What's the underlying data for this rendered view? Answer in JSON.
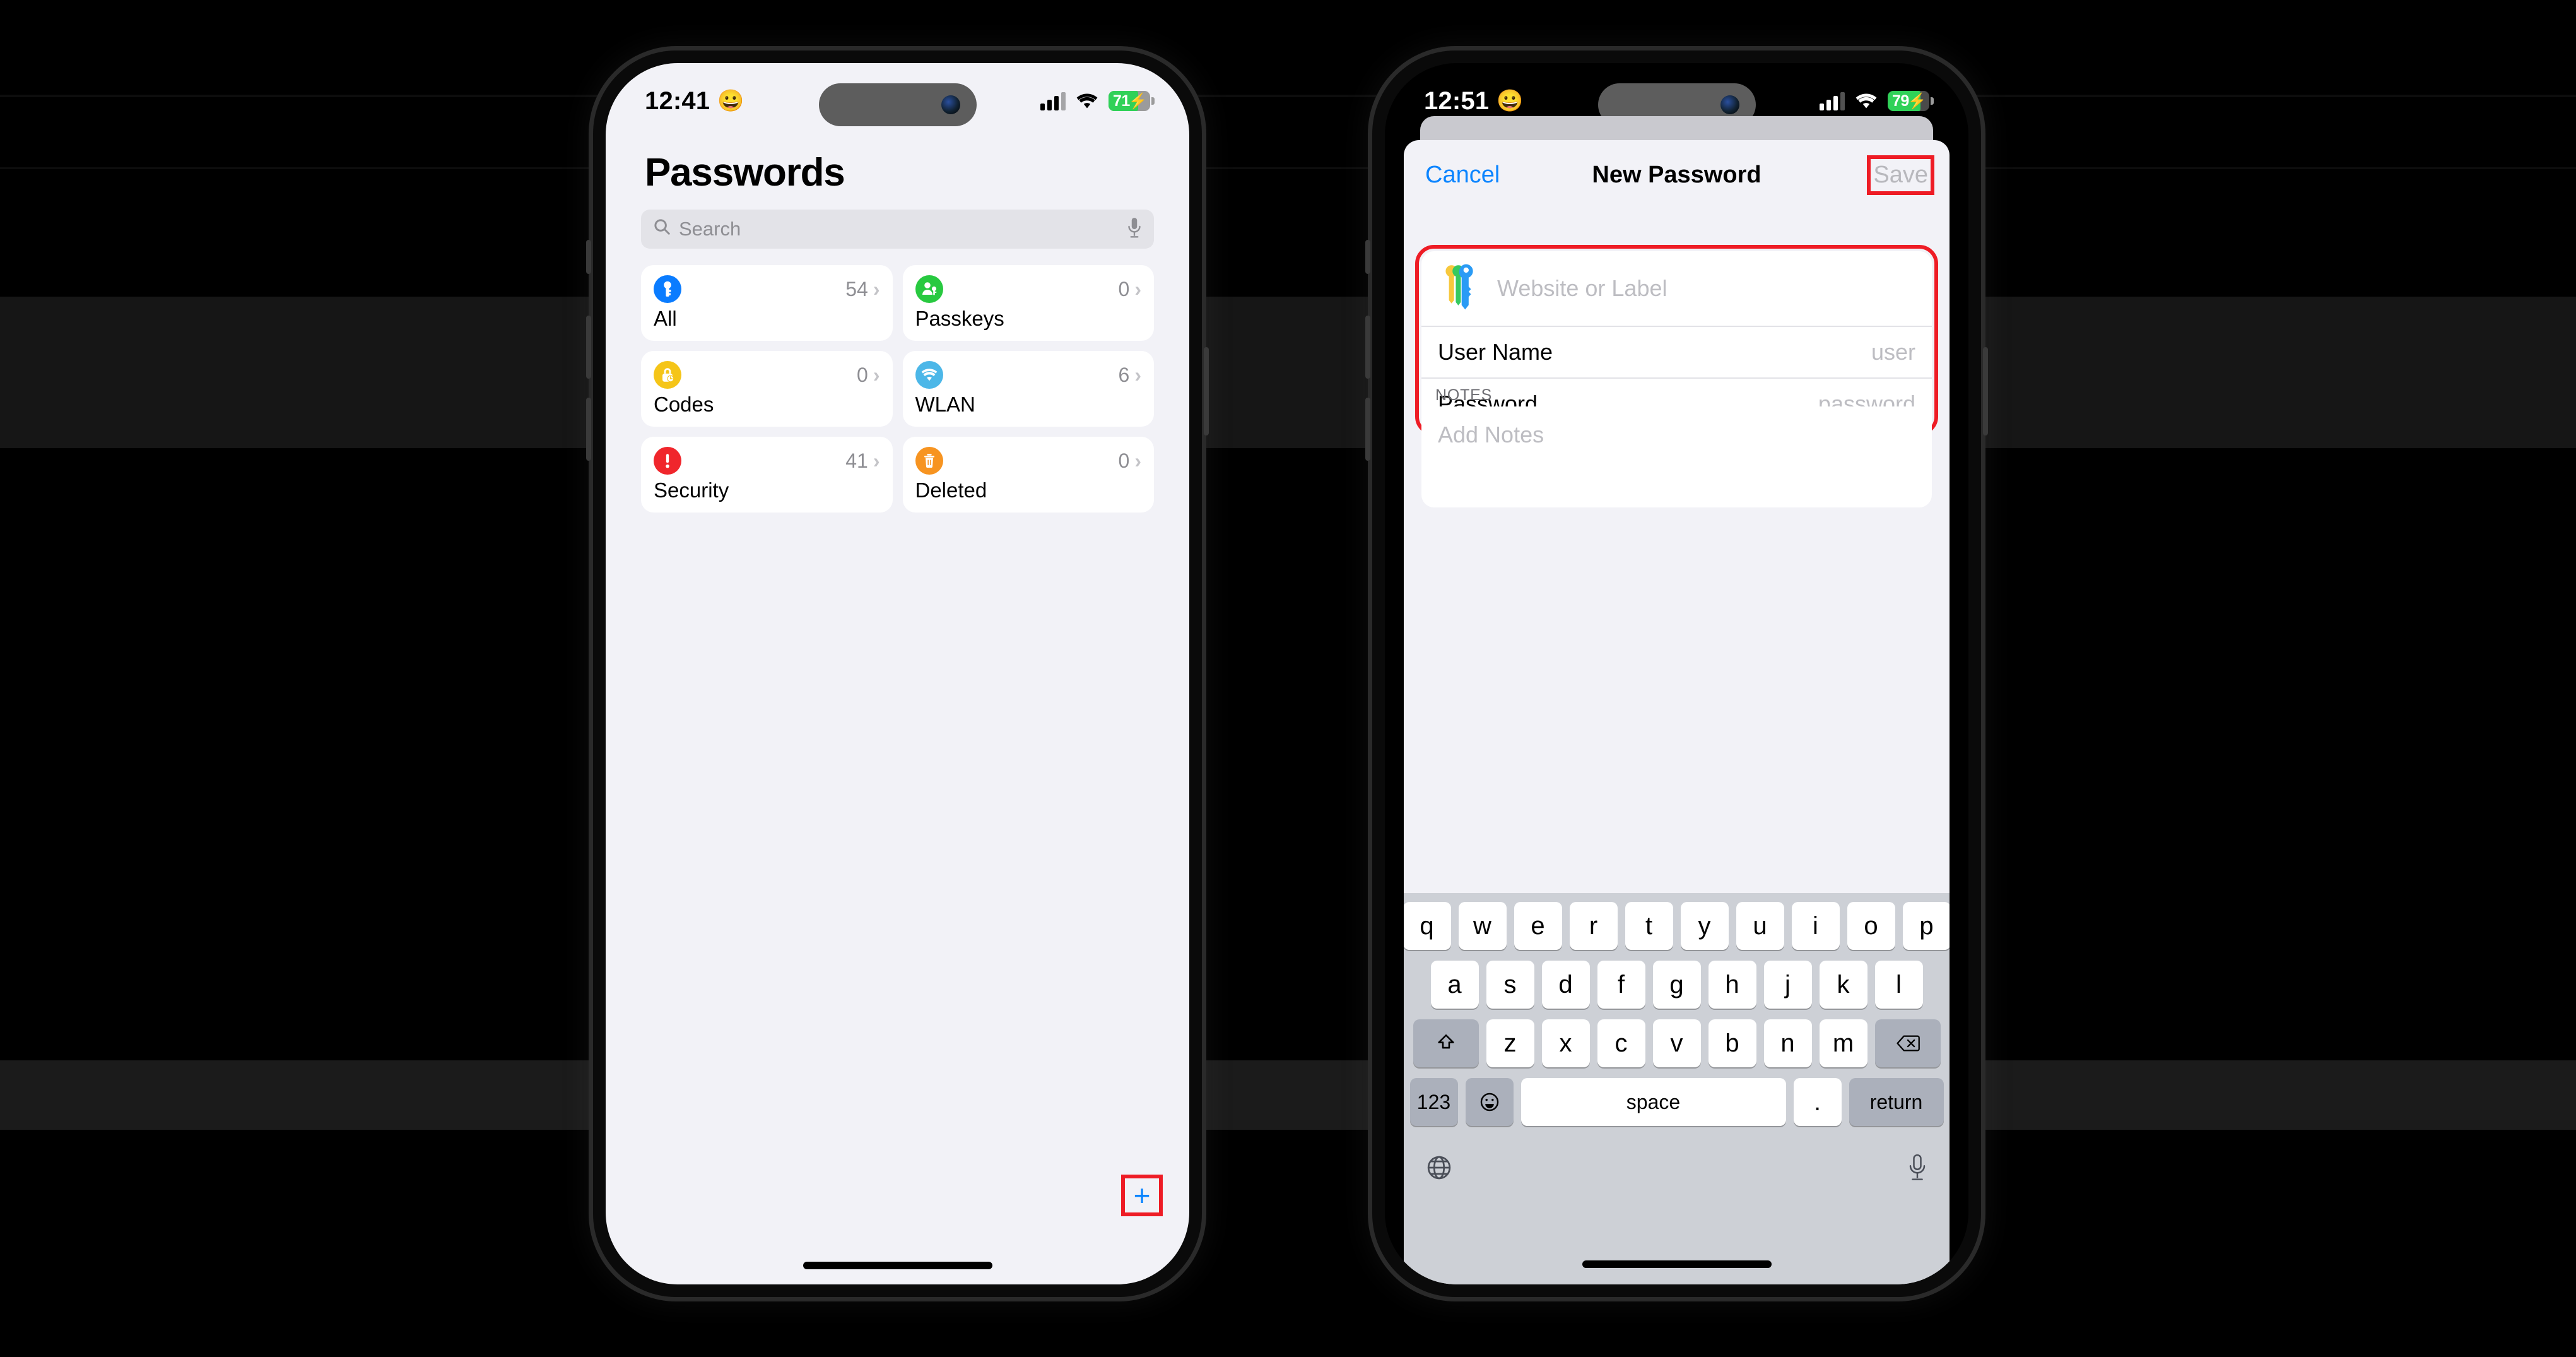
{
  "background": {
    "color": "#000000"
  },
  "accent": {
    "blue": "#0a84ff",
    "highlight_red": "#ee1c25"
  },
  "left_phone": {
    "status_bar": {
      "time": "12:41",
      "face_emoji": "😀",
      "battery_percent": "71",
      "signal_icon": "cellular-bars-icon",
      "wifi_icon": "wifi-icon",
      "battery_icon": "battery-charging-icon"
    },
    "page_title": "Passwords",
    "search": {
      "placeholder": "Search",
      "icon": "search-icon",
      "mic_icon": "microphone-icon"
    },
    "categories": [
      {
        "label": "All",
        "count": "54",
        "icon": "key-icon",
        "color": "#0a7cff",
        "chevron": "›"
      },
      {
        "label": "Passkeys",
        "count": "0",
        "icon": "person-key-icon",
        "color": "#28c940",
        "chevron": "›"
      },
      {
        "label": "Codes",
        "count": "0",
        "icon": "lock-clock-icon",
        "color": "#f5c518",
        "chevron": "›"
      },
      {
        "label": "WLAN",
        "count": "6",
        "icon": "wifi-icon",
        "color": "#4cb7e8",
        "chevron": "›"
      },
      {
        "label": "Security",
        "count": "41",
        "icon": "warning-icon",
        "color": "#f0262c",
        "chevron": "›"
      },
      {
        "label": "Deleted",
        "count": "0",
        "icon": "trash-icon",
        "color": "#f79421",
        "chevron": "›"
      }
    ],
    "add_button": {
      "label": "+",
      "icon": "plus-icon",
      "highlighted": true
    }
  },
  "right_phone": {
    "status_bar": {
      "time": "12:51",
      "face_emoji": "😀",
      "battery_percent": "79",
      "signal_icon": "cellular-bars-icon",
      "wifi_icon": "wifi-icon",
      "battery_icon": "battery-charging-icon"
    },
    "navbar": {
      "cancel_label": "Cancel",
      "title": "New Password",
      "save_label": "Save",
      "save_disabled": true,
      "save_highlighted": true
    },
    "form": {
      "highlighted": true,
      "app_icon": "passwords-keys-icon",
      "website_placeholder": "Website or Label",
      "rows": [
        {
          "label": "User Name",
          "placeholder": "user"
        },
        {
          "label": "Password",
          "placeholder": "password"
        }
      ]
    },
    "notes": {
      "header": "NOTES",
      "placeholder": "Add Notes"
    },
    "keyboard": {
      "row1": [
        "q",
        "w",
        "e",
        "r",
        "t",
        "y",
        "u",
        "i",
        "o",
        "p"
      ],
      "row2": [
        "a",
        "s",
        "d",
        "f",
        "g",
        "h",
        "j",
        "k",
        "l"
      ],
      "row3_letters": [
        "z",
        "x",
        "c",
        "v",
        "b",
        "n",
        "m"
      ],
      "shift_icon": "shift-up-icon",
      "backspace_icon": "backspace-icon",
      "numbers_label": "123",
      "emoji_icon": "emoji-smiley-icon",
      "space_label": "space",
      "period_label": ".",
      "return_label": "return",
      "globe_icon": "globe-icon",
      "dictation_icon": "microphone-icon"
    }
  }
}
